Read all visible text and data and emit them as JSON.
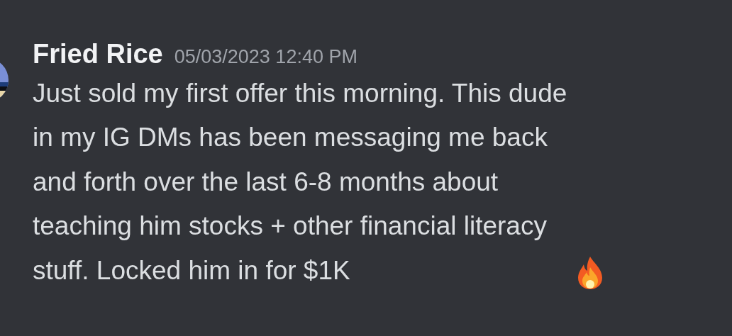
{
  "message": {
    "author": "Fried Rice",
    "timestamp": "05/03/2023 12:40 PM",
    "text": "Just sold my first offer this morning. This dude\nin my IG DMs has been messaging me back\nand forth over the last 6-8 months about\nteaching him stocks + other financial literacy\nstuff. Locked him in for $1K"
  }
}
